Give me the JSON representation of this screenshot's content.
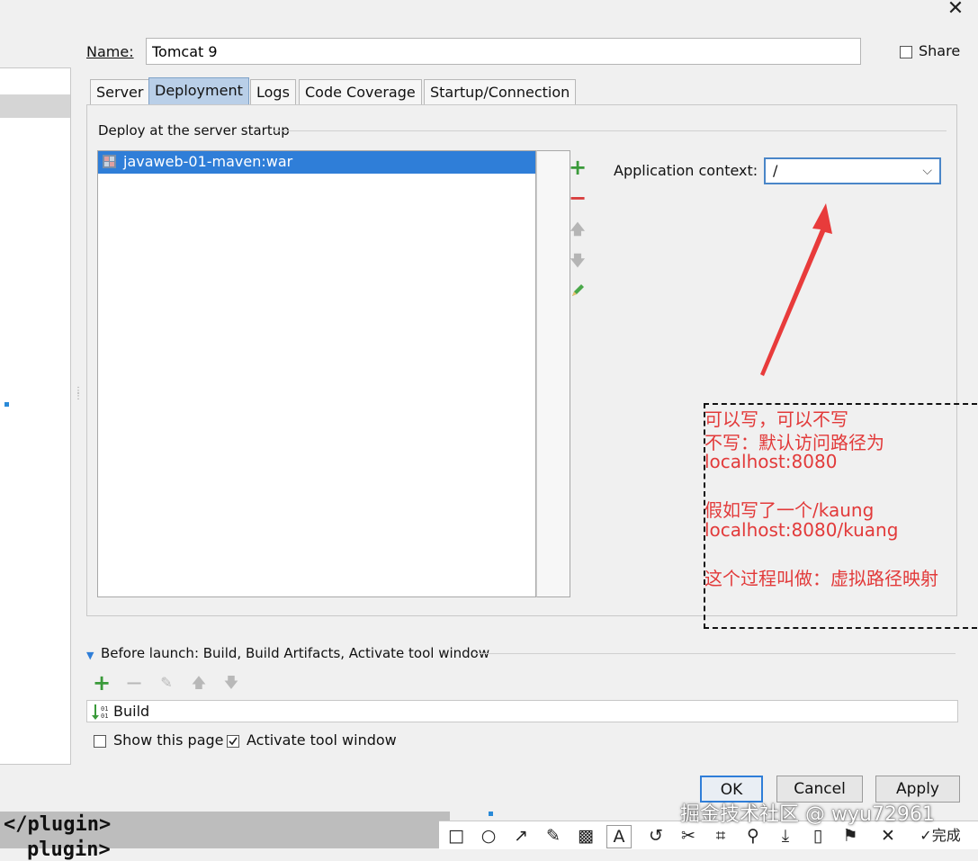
{
  "window": {
    "close_icon": "close-icon"
  },
  "name_row": {
    "label": "Name:",
    "value": "Tomcat 9",
    "share_label": "Share",
    "share_checked": false
  },
  "tabs": [
    {
      "label": "Server",
      "active": false
    },
    {
      "label": "Deployment",
      "active": true
    },
    {
      "label": "Logs",
      "active": false
    },
    {
      "label": "Code Coverage",
      "active": false
    },
    {
      "label": "Startup/Connection",
      "active": false
    }
  ],
  "deployment": {
    "section_title": "Deploy at the server startup",
    "artifacts": [
      {
        "label": "javaweb-01-maven:war",
        "icon": "artifact-icon",
        "selected": true
      }
    ],
    "toolbar": [
      "add-icon",
      "remove-icon",
      "move-up-icon",
      "move-down-icon",
      "edit-icon"
    ],
    "context_label": "Application context:",
    "context_value": "/"
  },
  "annotation": {
    "lines": [
      "可以写，可以不写",
      "不写：默认访问路径为",
      "localhost:8080",
      "假如写了一个/kaung",
      "localhost:8080/kuang",
      "这个过程叫做：虚拟路径映射"
    ],
    "color": "#e23a3a"
  },
  "before_launch": {
    "label": "Before launch: Build, Build Artifacts, Activate tool window",
    "items": [
      {
        "label": "Build",
        "icon": "build-icon"
      }
    ],
    "show_this_page": "Show this page",
    "show_this_page_checked": false,
    "activate_tool_window": "Activate tool window",
    "activate_tool_window_checked": true
  },
  "buttons": {
    "ok": "OK",
    "cancel": "Cancel",
    "apply": "Apply"
  },
  "background_code": [
    "</plugin>",
    "plugin>"
  ],
  "snip_toolbar": {
    "done_label": "完成"
  },
  "watermark": "掘金技术社区 @ wyu72961"
}
